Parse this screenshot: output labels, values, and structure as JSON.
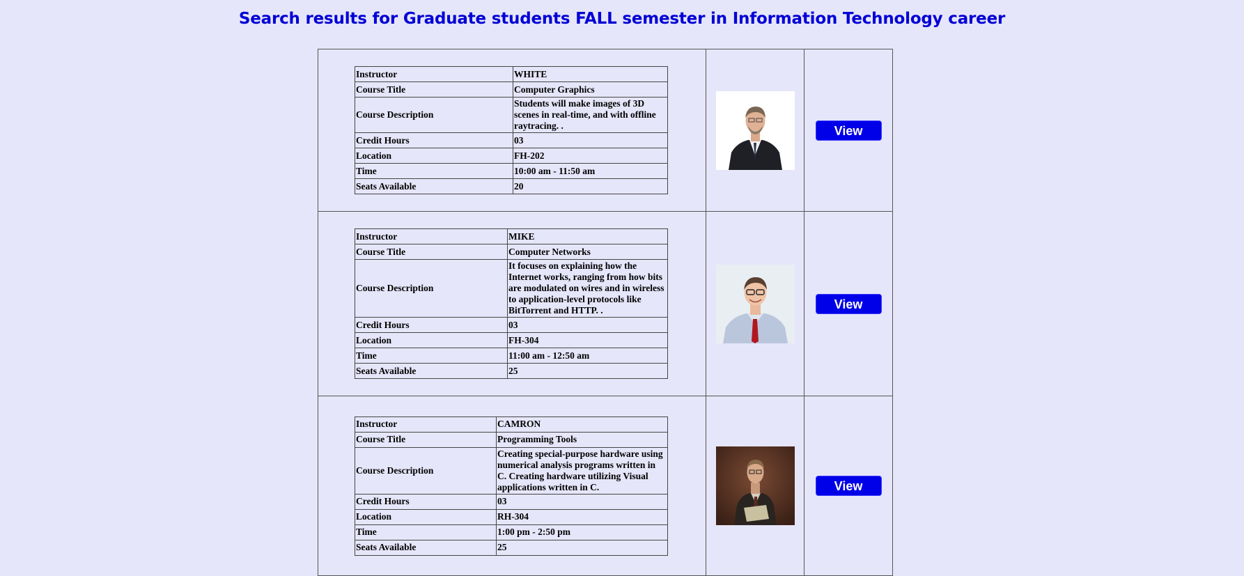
{
  "page": {
    "title": "Search results for Graduate students FALL semester in Information Technology career"
  },
  "labels": {
    "instructor": "Instructor",
    "course_title": "Course Title",
    "course_description": "Course Description",
    "credit_hours": "Credit Hours",
    "location": "Location",
    "time": "Time",
    "seats_available": "Seats Available"
  },
  "results": [
    {
      "instructor": "WHITE",
      "course_title": "Computer Graphics",
      "course_description": "Students will make images of 3D scenes in real-time, and with offline raytracing. .",
      "credit_hours": "03",
      "location": "FH-202",
      "time": "10:00 am - 11:50 am",
      "seats_available": "20",
      "view_label": "View"
    },
    {
      "instructor": "MIKE",
      "course_title": "Computer Networks",
      "course_description": "It focuses on explaining how the Internet works, ranging from how bits are modulated on wires and in wireless to application-level protocols like BitTorrent and HTTP. .",
      "credit_hours": "03",
      "location": "FH-304",
      "time": "11:00 am - 12:50 am",
      "seats_available": "25",
      "view_label": "View"
    },
    {
      "instructor": "CAMRON",
      "course_title": "Programming Tools",
      "course_description": "Creating special-purpose hardware using numerical analysis programs written in C. Creating hardware utilizing Visual applications written in C.",
      "credit_hours": "03",
      "location": "RH-304",
      "time": "1:00 pm - 2:50 pm",
      "seats_available": "25",
      "view_label": "View"
    }
  ]
}
